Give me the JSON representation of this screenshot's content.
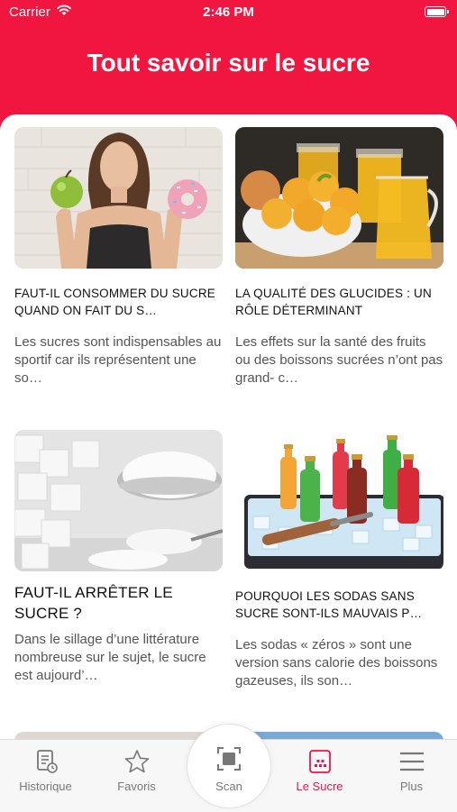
{
  "status_bar": {
    "carrier": "Carrier",
    "time": "2:46 PM"
  },
  "header": {
    "title": "Tout savoir sur le sucre"
  },
  "articles": [
    {
      "title": "FAUT-IL CONSOMMER DU SUCRE QUAND ON FAIT DU S…",
      "description": "Les sucres sont indispensables au sportif car ils représentent une so…",
      "image": "woman-apple-donut-image"
    },
    {
      "title": "LA QUALITÉ DES GLUCIDES : UN RÔLE DÉTERMINANT",
      "description": "Les effets sur la santé des fruits ou des boissons sucrées n’ont pas grand- c…",
      "image": "fruit-juice-image"
    },
    {
      "title": "FAUT-IL ARRÊTER LE SUCRE ?",
      "description": "Dans le sillage d’une littérature nombreuse sur le sujet, le sucre est aujourd’…",
      "image": "sugar-cubes-spoon-image"
    },
    {
      "title": "POURQUOI LES SODAS SANS SUCRE SONT-ILS MAUVAIS P…",
      "description": "Les sodas « zéros » sont une version sans calorie des boissons gazeuses, ils son…",
      "image": "soda-bottles-ice-image"
    }
  ],
  "tab_bar": {
    "historique": "Historique",
    "favoris": "Favoris",
    "scan": "Scan",
    "le_sucre": "Le Sucre",
    "plus": "Plus",
    "active_tab": "le_sucre"
  },
  "colors": {
    "brand": "#f0163f",
    "active_tab": "#e8174b",
    "inactive_tab": "#777777"
  }
}
